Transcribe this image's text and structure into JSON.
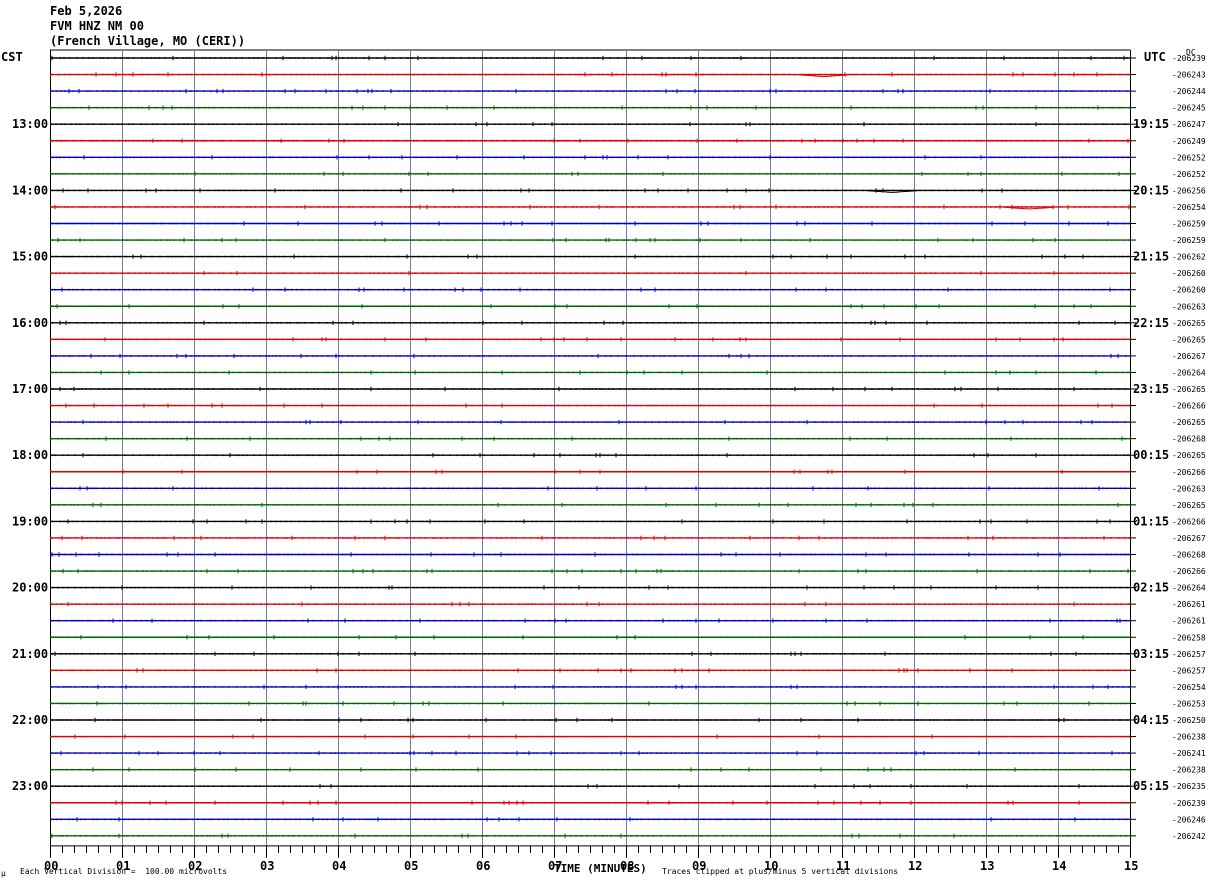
{
  "header": {
    "date": "Feb 5,2026",
    "station": "FVM HNZ NM 00",
    "location": "(French Village, MO (CERI))"
  },
  "corners": {
    "left_tz": "CST",
    "right_tz": "UTC",
    "dc_label": "DC"
  },
  "footer": {
    "scale_note": "Each Vertical Division =  100.00 microvolts",
    "clip_note": "Traces clipped at plus/minus 5 vertical divisions",
    "corner_mark": "µ"
  },
  "colors": {
    "cycle": [
      "#000000",
      "#e00000",
      "#0000cc",
      "#006600"
    ],
    "grid": "#7a7aa8"
  },
  "chart_data": {
    "type": "line",
    "xlabel": "TIME (MINUTES)",
    "xlim": [
      0,
      15
    ],
    "x_ticks": [
      "00",
      "01",
      "02",
      "03",
      "04",
      "05",
      "06",
      "07",
      "08",
      "09",
      "10",
      "11",
      "12",
      "13",
      "14",
      "15"
    ],
    "left_time_labels": [
      "13:00",
      "14:00",
      "15:00",
      "16:00",
      "17:00",
      "18:00",
      "19:00",
      "20:00",
      "21:00",
      "22:00",
      "23:00"
    ],
    "right_time_labels": [
      "19:15",
      "20:15",
      "21:15",
      "22:15",
      "23:15",
      "00:15",
      "01:15",
      "02:15",
      "03:15",
      "04:15",
      "05:15"
    ],
    "dc_offsets": [
      "-206239",
      "-206243",
      "-206244",
      "-206245",
      "-206247",
      "-206249",
      "-206252",
      "-206252",
      "-206256",
      "-206254",
      "-206259",
      "-206259",
      "-206262",
      "-206260",
      "-206260",
      "-206263",
      "-206265",
      "-206265",
      "-206267",
      "-206264",
      "-206265",
      "-206266",
      "-206265",
      "-206268",
      "-206265",
      "-206266",
      "-206263",
      "-206265",
      "-206266",
      "-206267",
      "-206268",
      "-206266",
      "-206264",
      "-206261",
      "-206261",
      "-206258",
      "-206257",
      "-206257",
      "-206254",
      "-206253",
      "-206250",
      "-206238",
      "-206241",
      "-206238",
      "-206235",
      "-206239",
      "-206246",
      "-206242"
    ],
    "events": [
      {
        "trace": 1,
        "minute": 10.75
      },
      {
        "trace": 9,
        "minute": 13.6
      },
      {
        "trace": 8,
        "minute": 11.7
      }
    ]
  }
}
